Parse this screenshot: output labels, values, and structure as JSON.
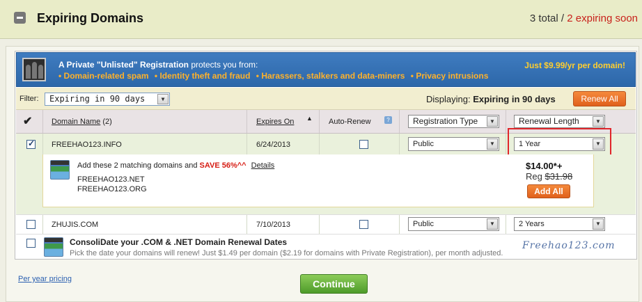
{
  "header": {
    "title": "Expiring Domains",
    "total": "3 total",
    "separator": "/",
    "expiring_soon": "2 expiring soon"
  },
  "banner": {
    "headline_bold": "A Private \"Unlisted\" Registration",
    "headline_rest": " protects you from:",
    "benefits": [
      "• Domain-related spam",
      "• Identity theft and fraud",
      "• Harassers, stalkers and data-miners",
      "• Privacy intrusions"
    ],
    "price": "Just $9.99/yr per domain!"
  },
  "filter": {
    "label": "Filter:",
    "value": "Expiring in 90 days",
    "displaying_label": "Displaying:",
    "displaying_value": "Expiring in 90 days",
    "renew_all": "Renew All"
  },
  "columns": {
    "select_all_icon": "checkmark-icon",
    "domain_name": "Domain Name",
    "domain_count": "(2)",
    "expires_on": "Expires On",
    "auto_renew": "Auto-Renew",
    "registration_type": "Registration Type",
    "renewal_length": "Renewal Length"
  },
  "rows": [
    {
      "checked": true,
      "domain": "FREEHAO123.INFO",
      "expires": "6/24/2013",
      "auto_renew": false,
      "registration_type": "Public",
      "renewal_length": "1 Year"
    },
    {
      "checked": false,
      "domain": "ZHUJIS.COM",
      "expires": "7/10/2013",
      "auto_renew": false,
      "registration_type": "Public",
      "renewal_length": "2 Years"
    }
  ],
  "upsell": {
    "text_before": "Add these 2 matching domains and ",
    "save": "SAVE 56%^^",
    "details": "Details",
    "domains": [
      "FREEHAO123.NET",
      "FREEHAO123.ORG"
    ],
    "price_new": "$14.00*+",
    "reg_label": "Reg ",
    "price_old": "$31.98",
    "add_all": "Add All"
  },
  "consolidate": {
    "title": "ConsoliDate your .COM & .NET Domain Renewal Dates",
    "subtitle": "Pick the date your domains will renew! Just $1.49 per domain ($2.19 for domains with Private Registration), per month adjusted."
  },
  "watermark": "Freehao123.com",
  "footer": {
    "per_year_link": "Per year pricing",
    "continue": "Continue"
  },
  "colors": {
    "accent_orange": "#e0601c",
    "red": "#c8211b",
    "banner_blue": "#2d67a9",
    "continue_green": "#4e9b2a"
  }
}
